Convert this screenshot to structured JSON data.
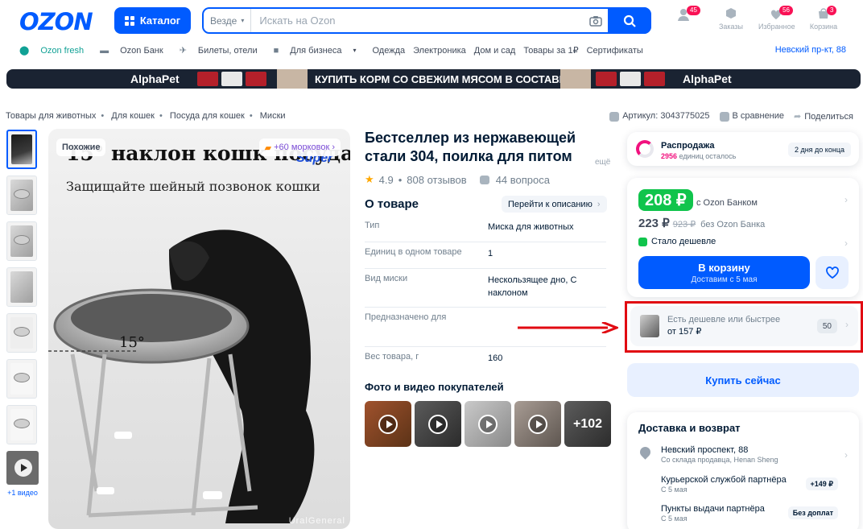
{
  "header": {
    "logo": "OZON",
    "catalog_label": "Каталог",
    "search_scope": "Везде",
    "search_placeholder": "Искать на Ozon",
    "icons": [
      {
        "name": "profile",
        "label": "",
        "badge": "45"
      },
      {
        "name": "orders",
        "label": "Заказы",
        "badge": ""
      },
      {
        "name": "favorites",
        "label": "Избранное",
        "badge": "56"
      },
      {
        "name": "cart",
        "label": "Корзина",
        "badge": "3"
      }
    ]
  },
  "nav": {
    "items": [
      "Ozon fresh",
      "Ozon Банк",
      "Билеты, отели",
      "Для бизнеса",
      "Одежда",
      "Электроника",
      "Дом и сад",
      "Товары за 1₽",
      "Сертификаты"
    ],
    "address": "Невский пр-кт, 88"
  },
  "banner": {
    "brand": "AlphaPet",
    "slogan": "КУПИТЬ КОРМ СО СВЕЖИМ МЯСОМ В СОСТАВЕ"
  },
  "breadcrumbs": [
    "Товары для животных",
    "Для кошек",
    "Посуда для кошек",
    "Миски"
  ],
  "meta": {
    "article": "Артикул: 3043775025",
    "compare": "В сравнение",
    "share": "Поделиться"
  },
  "gallery": {
    "video_label": "+1 видео",
    "chip_left": "Похожие",
    "chip_right": "+60 морковок",
    "image_text_1": "15° наклон кошк посуда",
    "image_text_2": "Защищайте шейный позвонок кошки",
    "image_brand": "Super",
    "angle_label": "15°",
    "watermark": "UralGeneral"
  },
  "product": {
    "title": "Бестселлер из нержавеющей стали 304, поилка для питом",
    "title_more": "ещё",
    "rating": "4.9",
    "reviews": "808 отзывов",
    "questions": "44 вопроса",
    "about_title": "О товаре",
    "goto_desc": "Перейти к описанию",
    "props": [
      {
        "k": "Тип",
        "v": "Миска для животных"
      },
      {
        "k": "Единиц в одном товаре",
        "v": "1"
      },
      {
        "k": "Вид миски",
        "v": "Нескользящее дно, С наклоном"
      },
      {
        "k": "Предназначено для",
        "v": ""
      },
      {
        "k": "Вес товара, г",
        "v": "160"
      }
    ],
    "photos_title": "Фото и видео покупателей",
    "photos_more": "+102"
  },
  "sidebar": {
    "sale_title": "Распродажа",
    "sale_count": "2956",
    "sale_left": "единиц осталось",
    "sale_pill": "2 дня до конца",
    "price_card": "208 ₽",
    "price_card_label": "с Ozon Банком",
    "price_regular": "223 ₽",
    "price_old": "923 ₽",
    "price_regular_label": "без Ozon Банка",
    "cheaper_label": "Стало дешевле",
    "cart_button": "В корзину",
    "cart_sub": "Доставим с 5 мая",
    "alt_title": "Есть дешевле или быстрее",
    "alt_price": "от 157 ₽",
    "alt_count": "50",
    "buy_now": "Купить сейчас",
    "delivery_title": "Доставка и возврат",
    "delivery": [
      {
        "a": "Невский проспект, 88",
        "b": "Со склада продавца, Henan Sheng",
        "tag": ""
      },
      {
        "a": "Курьерской службой партнёра",
        "b": "С 5 мая",
        "tag": "+149 ₽"
      },
      {
        "a": "Пункты выдачи партнёра",
        "b": "С 5 мая",
        "tag": "Без доплат"
      }
    ]
  },
  "colors": {
    "accent": "#005bff",
    "green": "#10c44c",
    "pink": "#f1117e",
    "highlight": "#e10a12"
  }
}
